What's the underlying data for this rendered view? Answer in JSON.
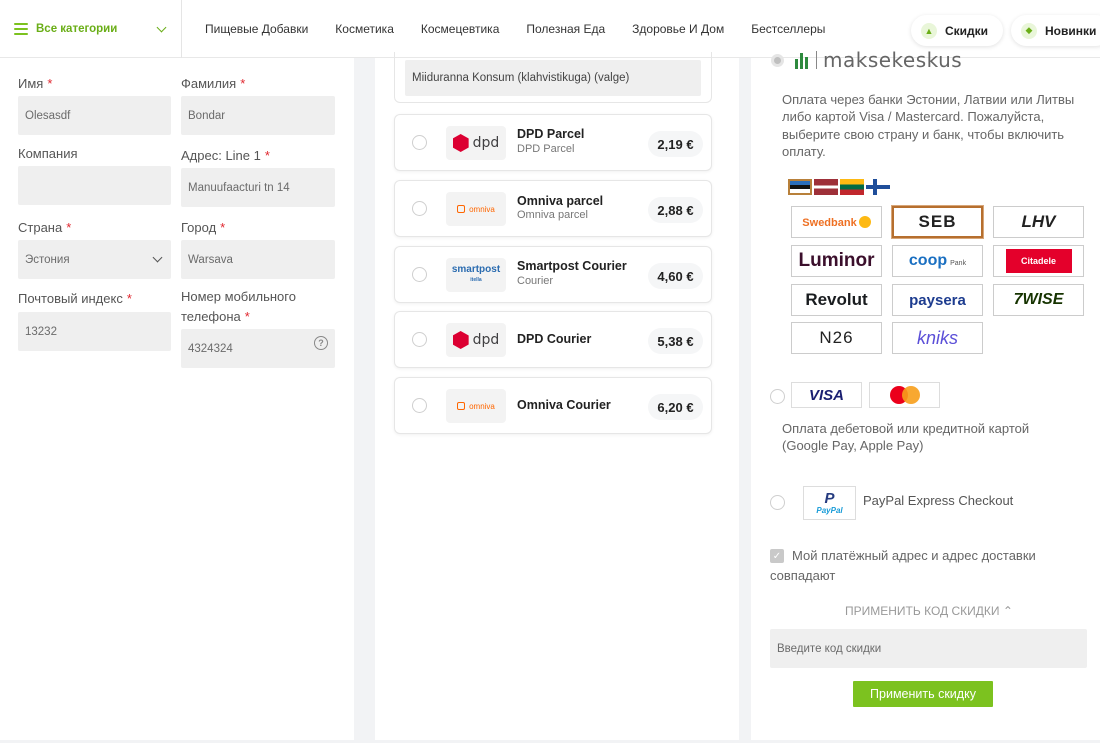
{
  "nav": {
    "categories_label": "Все категории",
    "menu": [
      "Пищевые Добавки",
      "Косметика",
      "Космецевтика",
      "Полезная Еда",
      "Здоровье И Дом",
      "Бестселлеры"
    ],
    "sale_label": "Скидки",
    "new_label": "Новинки",
    "accent_color": "#7cc21f"
  },
  "form": {
    "first_name": {
      "label": "Имя",
      "value": "Olesasdf",
      "required": "*"
    },
    "last_name": {
      "label": "Фамилия",
      "value": "Bondar",
      "required": "*"
    },
    "company": {
      "label": "Компания",
      "value": ""
    },
    "address": {
      "label": "Адрес: Line 1",
      "value": "Manuufaacturi tn 14",
      "required": "*"
    },
    "country": {
      "label": "Страна",
      "value": "Эстония",
      "required": "*"
    },
    "city": {
      "label": "Город",
      "value": "Warsava",
      "required": "*"
    },
    "postcode": {
      "label": "Почтовый индекс",
      "value": "13232",
      "required": "*"
    },
    "phone": {
      "label": "Номер мобильного телефона",
      "value": "4324324",
      "required": "*",
      "help": "?"
    }
  },
  "shipping": {
    "pickup_point": "Miiduranna Konsum (klahvistikuga) (valge)",
    "options": [
      {
        "name": "DPD Parcel",
        "sub": "DPD Parcel",
        "price": "2,19 €",
        "carrier": "dpd",
        "logo_text": "dpd"
      },
      {
        "name": "Omniva parcel",
        "sub": "Omniva parcel",
        "price": "2,88 €",
        "carrier": "omniva",
        "logo_text": "omniva"
      },
      {
        "name": "Smartpost Courier",
        "sub": "Courier",
        "price": "4,60 €",
        "carrier": "smartpost",
        "logo_text": "smartpost",
        "logo_sub": "itella"
      },
      {
        "name": "DPD Courier",
        "sub": "",
        "price": "5,38 €",
        "carrier": "dpd",
        "logo_text": "dpd"
      },
      {
        "name": "Omniva Courier",
        "sub": "",
        "price": "6,20 €",
        "carrier": "omniva",
        "logo_text": "omniva"
      }
    ]
  },
  "payment": {
    "maksekeskus": {
      "logo_text": "maksekeskus",
      "description": "Оплата через банки Эстонии, Латвии или Литвы либо картой Visa / Mastercard. Пожалуйста, выберите свою страну и банк, чтобы включить оплату.",
      "flags": [
        "Estonia",
        "Latvia",
        "Lithuania",
        "Finland"
      ],
      "banks": [
        {
          "name": "Swedbank",
          "selected": false
        },
        {
          "name": "SEB",
          "selected": true
        },
        {
          "name": "LHV",
          "selected": false
        },
        {
          "name": "Luminor",
          "selected": false
        },
        {
          "name": "coop",
          "sub": "Pank",
          "selected": false
        },
        {
          "name": "Citadele",
          "selected": false
        },
        {
          "name": "Revolut",
          "selected": false
        },
        {
          "name": "paysera",
          "selected": false
        },
        {
          "name": "7WISE",
          "selected": false
        },
        {
          "name": "N26",
          "selected": false
        },
        {
          "name": "kniks",
          "selected": false
        }
      ]
    },
    "cards": {
      "visa_label": "VISA",
      "mastercard_label": "mastercard",
      "description": "Оплата дебетовой или кредитной картой (Google Pay, Apple Pay)"
    },
    "paypal": {
      "logo_p": "P",
      "logo_text": "PayPal",
      "label": "PayPal Express Checkout"
    },
    "same_address": {
      "checked": true,
      "label": "Мой платёжный адрес и адрес доставки совпадают"
    },
    "coupon": {
      "toggle_label": "ПРИМЕНИТЬ КОД СКИДКИ",
      "placeholder": "Введите код скидки",
      "apply_label": "Применить скидку"
    }
  }
}
